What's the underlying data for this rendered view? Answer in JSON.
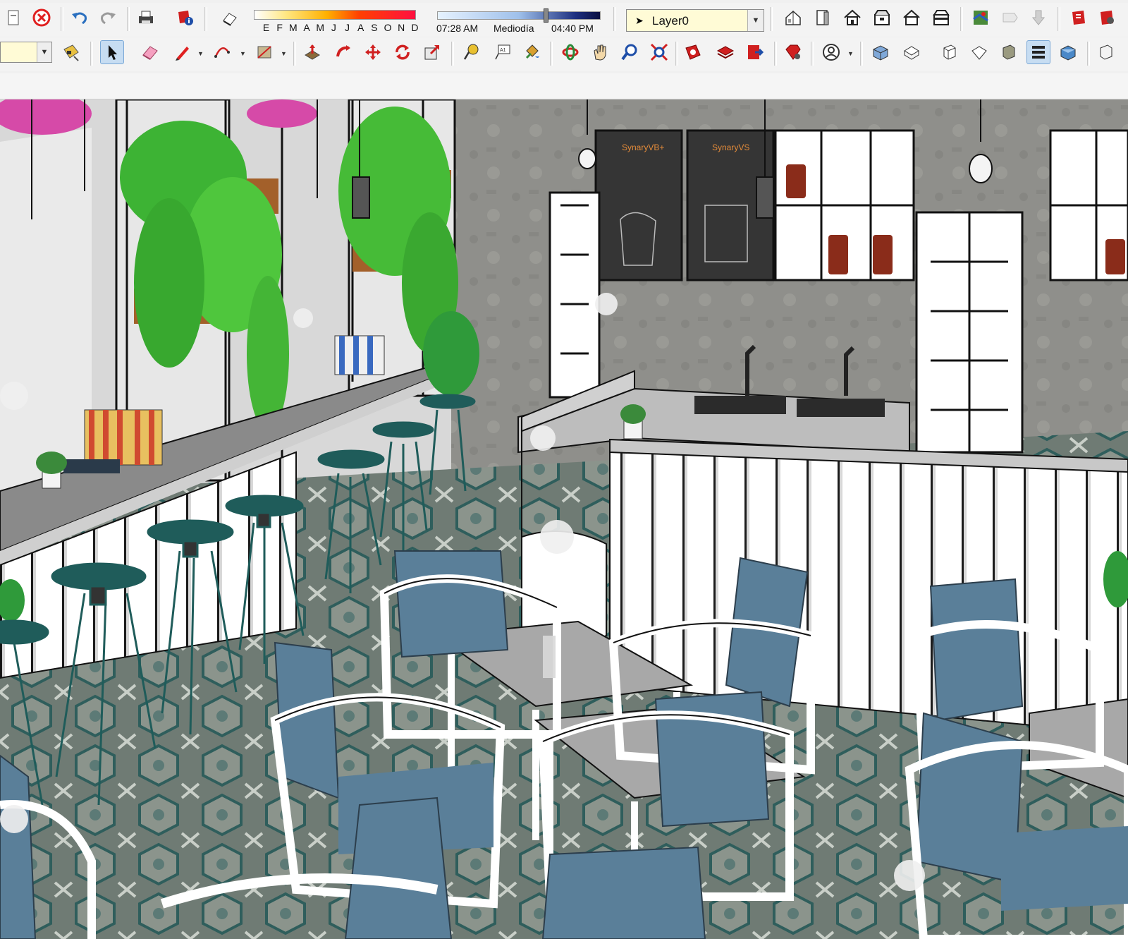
{
  "toolbar": {
    "shadow_months": [
      "E",
      "F",
      "M",
      "A",
      "M",
      "J",
      "J",
      "A",
      "S",
      "O",
      "N",
      "D"
    ],
    "time_start": "07:28 AM",
    "time_mid": "Mediodía",
    "time_end": "04:40 PM",
    "active_layer": "Layer0",
    "active_tool": "select"
  },
  "scene": {
    "poster_left_title": "SynaryVB+",
    "poster_right_title": "SynaryVS"
  },
  "icons": {
    "row1": [
      "new-file-icon",
      "stop-icon",
      "undo-icon",
      "redo-icon",
      "print-icon",
      "model-info-icon",
      "shadows-icon",
      "house-iso-icon",
      "front-view-icon",
      "home-icon",
      "top-view-icon",
      "back-view-icon",
      "right-view-icon",
      "geo-location-icon",
      "photo-texture-icon",
      "preview-location-icon",
      "render-icon",
      "render-2-icon"
    ],
    "row2": [
      "style-icon",
      "select-icon",
      "eraser-icon",
      "pencil-icon",
      "arc-icon",
      "rectangle-icon",
      "push-pull-icon",
      "follow-me-icon",
      "move-icon",
      "rotate-icon",
      "scale-icon",
      "tape-measure-icon",
      "text-icon",
      "paint-bucket-icon",
      "orbit-icon",
      "pan-icon",
      "zoom-icon",
      "zoom-extents-icon",
      "render-icon",
      "render-material-icon",
      "render-output-icon",
      "ruby-icon",
      "account-icon",
      "iso-view-icon",
      "top-view-icon",
      "front-view-icon",
      "right-view-icon",
      "back-view-icon",
      "left-view-icon",
      "xray-icon",
      "wireframe-icon",
      "hidden-line-icon",
      "shaded-icon",
      "shaded-textures-icon"
    ]
  },
  "colors": {
    "accent_active": "#c7ddf2",
    "layer_field": "#fffbd6",
    "stool_teal": "#1f5c5a",
    "chair_cushion": "#5a7f99",
    "wall_concrete": "#8e8e8a",
    "plant_green": "#3bbf2e",
    "wood": "#a06028"
  }
}
